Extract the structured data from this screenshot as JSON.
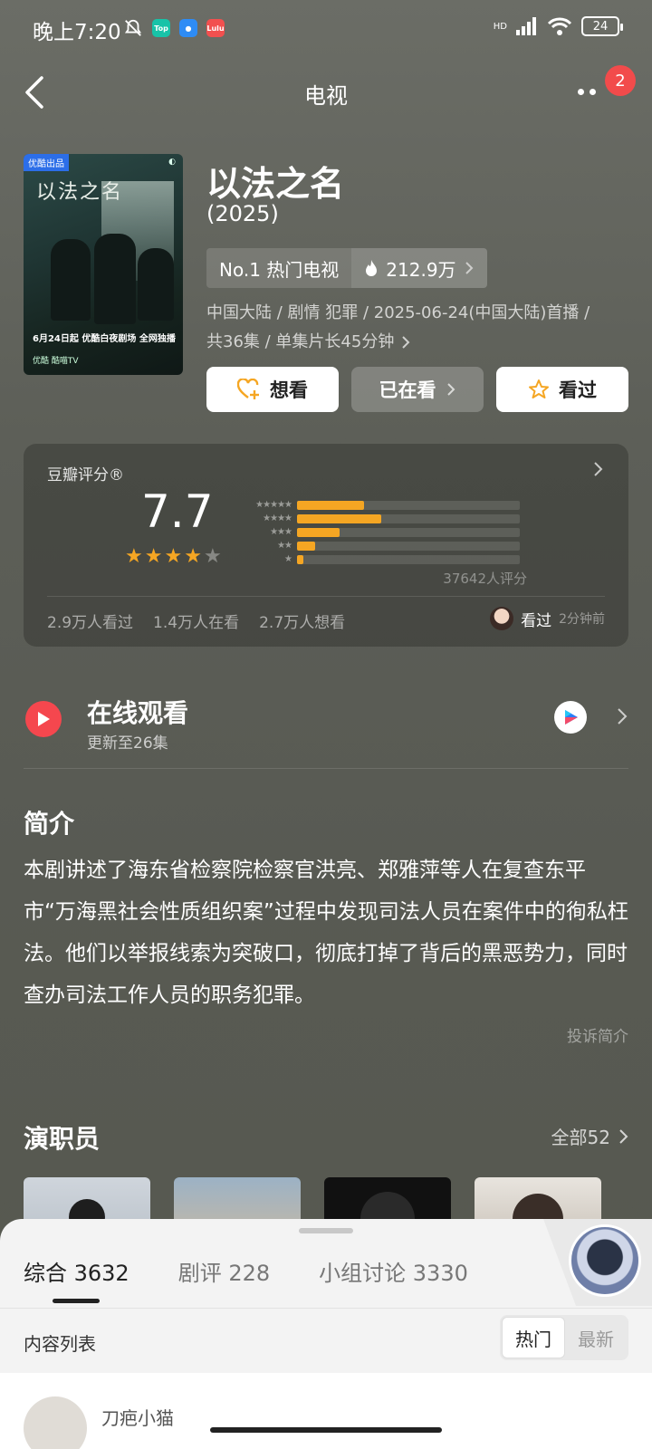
{
  "status_bar": {
    "time": "晚上7:20",
    "battery": "24",
    "network": "HD"
  },
  "header": {
    "title": "电视",
    "notification_count": "2"
  },
  "movie": {
    "poster": {
      "tag": "优酷出品",
      "title_art": "以法之名",
      "date_line": "6月24日起 优酷白夜剧场 全网独播",
      "platforms": "优酷  酷喵TV"
    },
    "title": "以法之名",
    "year": "(2025)",
    "rank_label": "No.1 热门电视",
    "heat": "212.9万",
    "meta_line1": "中国大陆 / 剧情 犯罪 / 2025-06-24(中国大陆)首播 /",
    "meta_line2": "共36集 / 单集片长45分钟"
  },
  "actions": {
    "want": "想看",
    "watching": "已在看",
    "watched": "看过"
  },
  "rating": {
    "label": "豆瓣评分®",
    "score": "7.7",
    "stars": 4,
    "distribution": [
      0.3,
      0.38,
      0.19,
      0.08,
      0.03
    ],
    "count_text": "37642人评分",
    "watched": "2.9万人看过",
    "watching": "1.4万人在看",
    "want": "2.7万人想看",
    "recent_action": "看过",
    "recent_time": "2分钟前"
  },
  "online": {
    "title": "在线观看",
    "subtitle": "更新至26集"
  },
  "synopsis": {
    "title": "简介",
    "text": "本剧讲述了海东省检察院检察官洪亮、郑雅萍等人在复查东平市“万海黑社会性质组织案”过程中发现司法人员在案件中的徇私枉法。他们以举报线索为突破口，彻底打掉了背后的黑恶势力，同时查办司法工作人员的职务犯罪。",
    "report": "投诉简介"
  },
  "cast": {
    "title": "演职员",
    "all_label": "全部52"
  },
  "sheet": {
    "tabs": [
      "综合 3632",
      "剧评 228",
      "小组讨论 3330"
    ],
    "list_label": "内容列表",
    "sort_hot": "热门",
    "sort_new": "最新",
    "first_user": "刀疤小猫"
  },
  "colors": {
    "accent_orange": "#f5a623",
    "play_red": "#f5474e",
    "badge_red": "#f24b4b"
  }
}
